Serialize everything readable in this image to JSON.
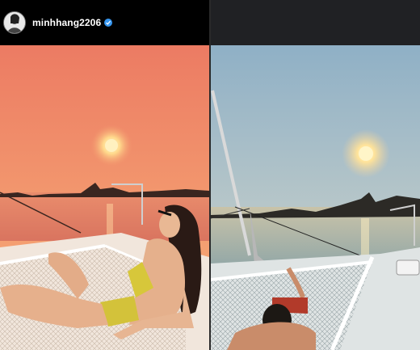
{
  "post": {
    "username": "minhhang2206",
    "verified": true
  },
  "photos": [
    {
      "subject": "left-sunset-catamaran-photo"
    },
    {
      "subject": "right-sunset-catamaran-photo"
    }
  ],
  "colors": {
    "verified_blue": "#3797f0",
    "left_sky": "#f08a6a",
    "right_sky": "#9fb8c8"
  }
}
